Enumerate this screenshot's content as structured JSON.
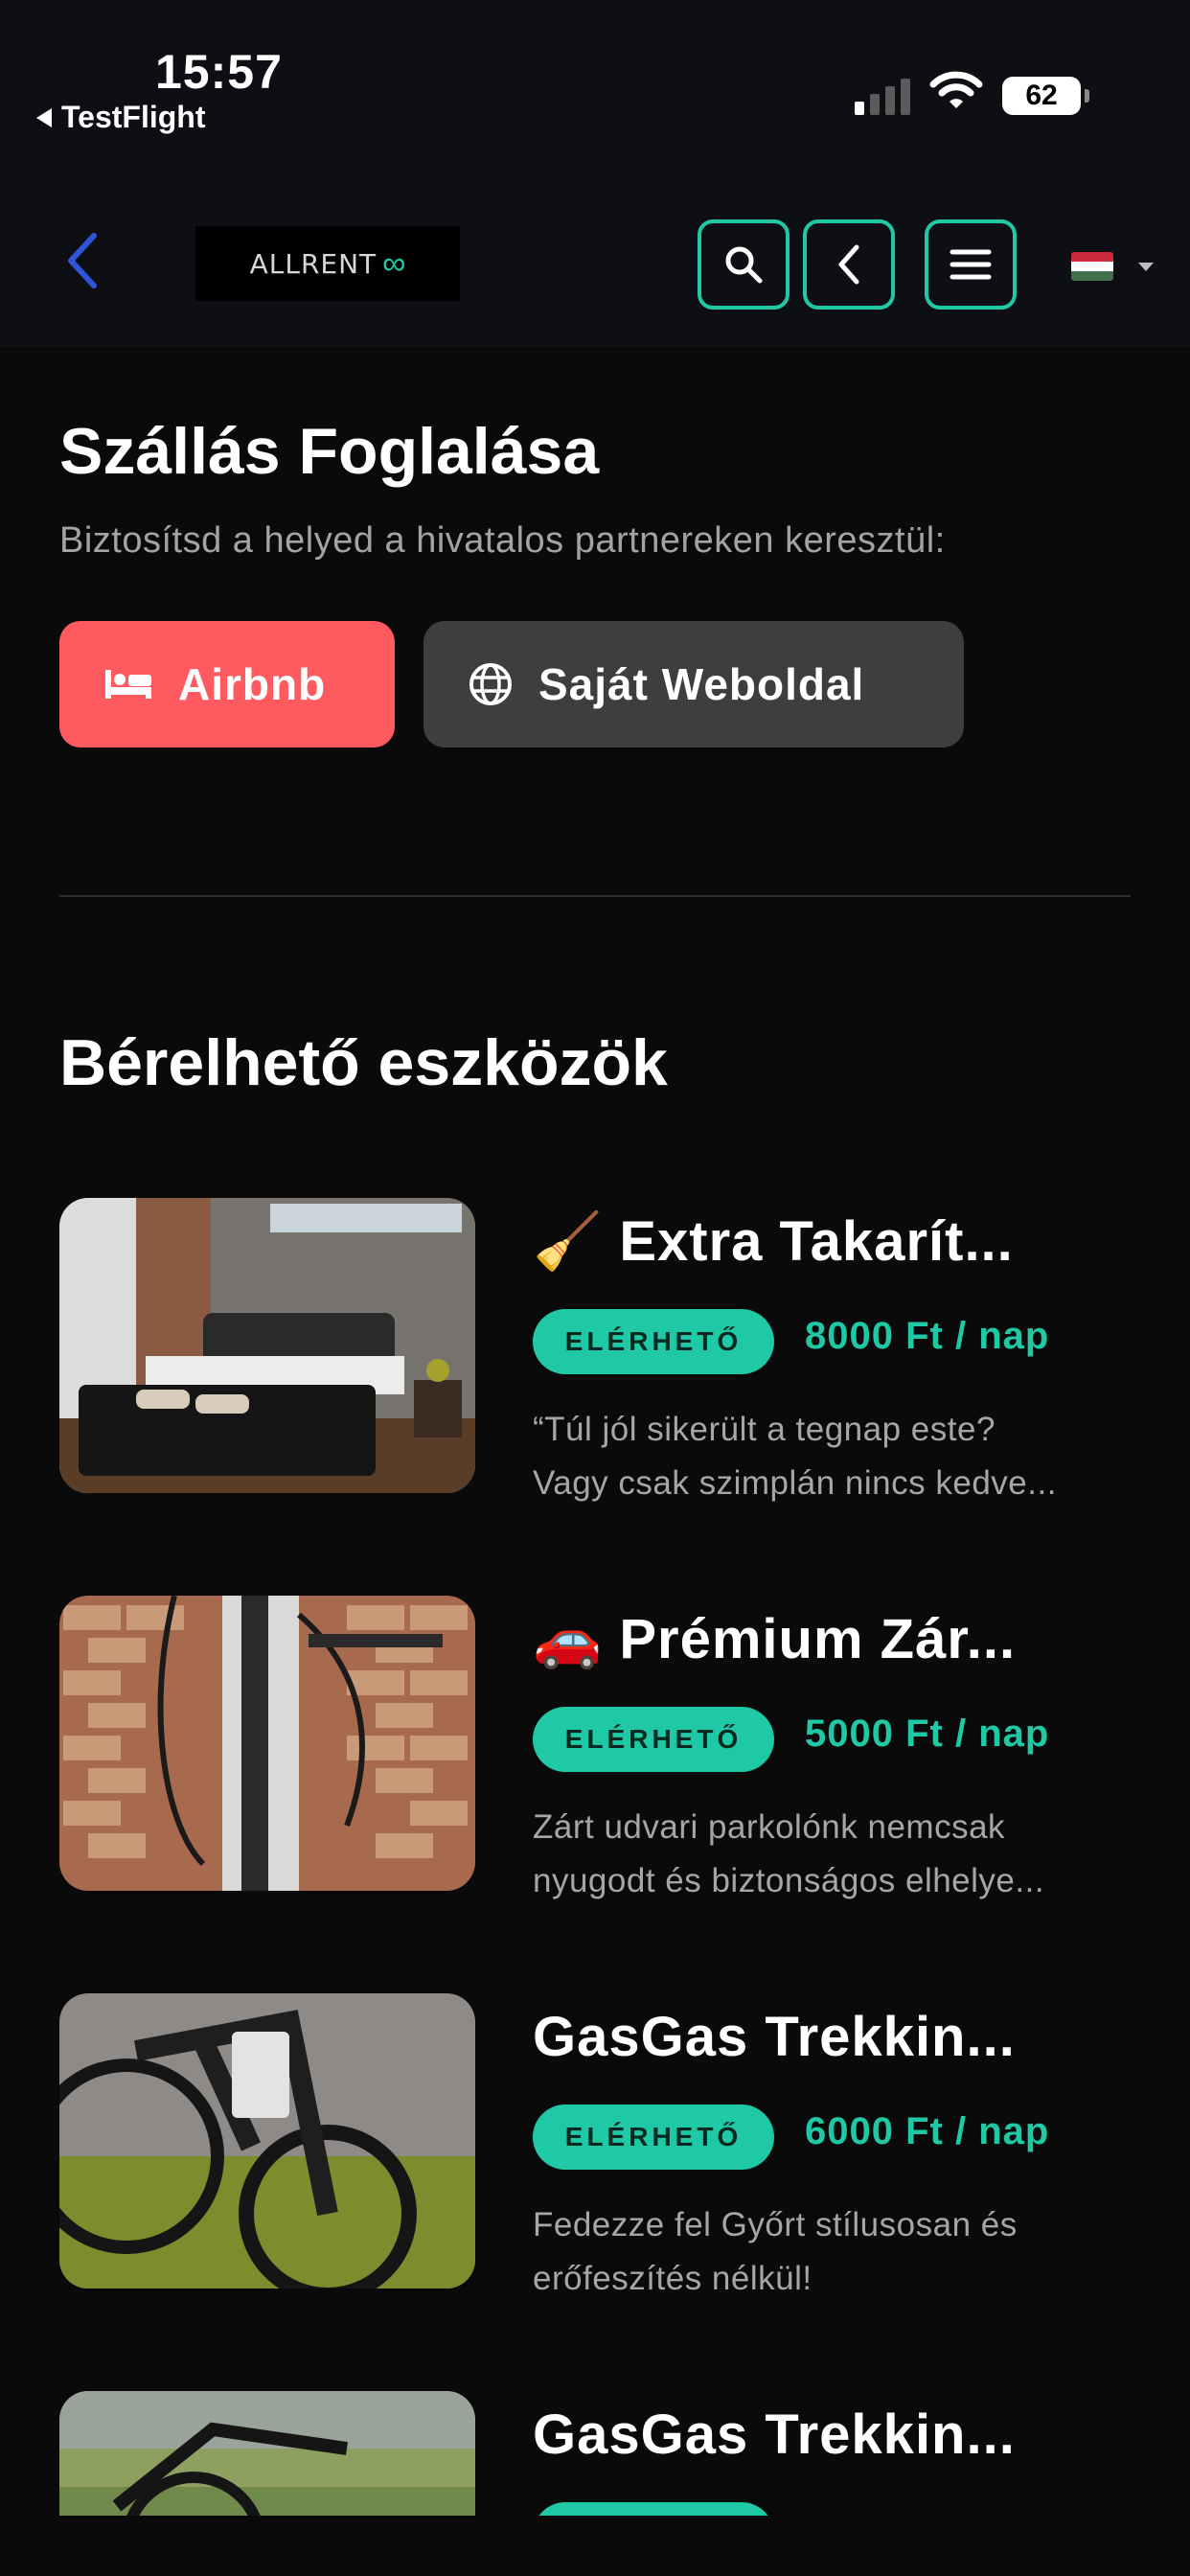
{
  "status_bar": {
    "time": "15:57",
    "back_app": "TestFlight",
    "battery": "62"
  },
  "header": {
    "logo_text": "ALLRENT",
    "logo_symbol": "∞"
  },
  "booking": {
    "title": "Szállás Foglalása",
    "subtitle": "Biztosítsd a helyed a hivatalos partnereken keresztül:",
    "airbnb_label": "Airbnb",
    "website_label": "Saját Weboldal"
  },
  "rentals": {
    "title": "Bérelhető eszközök",
    "items": [
      {
        "icon": "🧹",
        "title": "Extra Takarít...",
        "status": "ELÉRHETŐ",
        "price": "8000 Ft / nap",
        "desc1": "“Túl jól sikerült a tegnap este?",
        "desc2": "Vagy csak szimplán nincs kedve..."
      },
      {
        "icon": "🚗",
        "title": "Prémium Zár...",
        "status": "ELÉRHETŐ",
        "price": "5000 Ft / nap",
        "desc1": "Zárt udvari parkolónk nemcsak",
        "desc2": "nyugodt és biztonságos elhelye..."
      },
      {
        "icon": "",
        "title": "GasGas Trekkin...",
        "status": "ELÉRHETŐ",
        "price": "6000 Ft / nap",
        "desc1": "Fedezze fel Győrt stílusosan és",
        "desc2": "erőfeszítés nélkül!"
      },
      {
        "icon": "",
        "title": "GasGas Trekkin..."
      }
    ]
  },
  "colors": {
    "accent": "#1fc9a5",
    "airbnb": "#ff5a5f",
    "secondary_button": "#3e3e3e",
    "background": "#0a0a0a"
  }
}
